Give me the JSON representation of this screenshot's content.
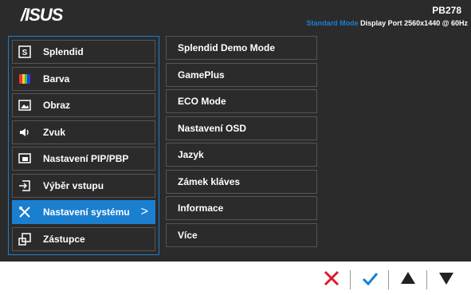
{
  "header": {
    "logo_text": "/ISUS",
    "model": "PB278",
    "mode": "Standard Mode",
    "status": "Display Port  2560x1440 @ 60Hz"
  },
  "menu": {
    "items": [
      {
        "label": "Splendid",
        "icon": "splendid-icon"
      },
      {
        "label": "Barva",
        "icon": "color-icon"
      },
      {
        "label": "Obraz",
        "icon": "image-icon"
      },
      {
        "label": "Zvuk",
        "icon": "speaker-icon"
      },
      {
        "label": "Nastavení PIP/PBP",
        "icon": "pip-icon"
      },
      {
        "label": "Výběr vstupu",
        "icon": "input-icon"
      },
      {
        "label": "Nastavení systému",
        "icon": "wrench-icon",
        "active": true
      },
      {
        "label": "Zástupce",
        "icon": "shortcut-icon"
      }
    ],
    "active_chevron": ">"
  },
  "submenu": {
    "items": [
      "Splendid Demo Mode",
      "GamePlus",
      "ECO Mode",
      "Nastavení OSD",
      "Jazyk",
      "Zámek kláves",
      "Informace",
      "Více"
    ]
  },
  "colors": {
    "accent": "#1b7fd0",
    "background": "#2b2b2b",
    "close": "#e0182b"
  },
  "buttons": [
    "close-icon",
    "check-icon",
    "up-arrow-icon",
    "down-arrow-icon"
  ]
}
